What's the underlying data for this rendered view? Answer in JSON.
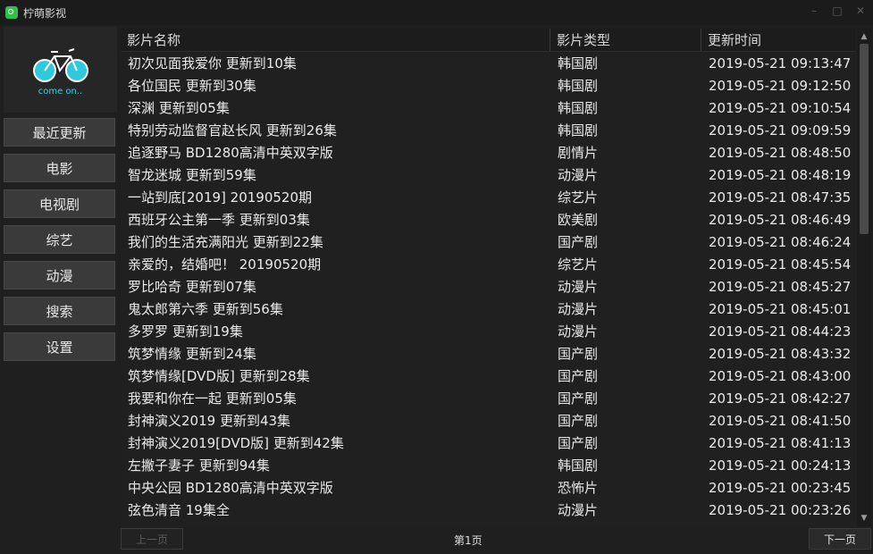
{
  "window": {
    "title": "柠萌影视",
    "app_icon": "app-logo-icon",
    "controls": [
      "minimize-icon",
      "maximize-icon",
      "close-icon"
    ]
  },
  "logo": {
    "text": "come on..",
    "icon": "bicycle-icon",
    "accent_color": "#3fd0e6"
  },
  "nav": [
    {
      "label": "最近更新"
    },
    {
      "label": "电影"
    },
    {
      "label": "电视剧"
    },
    {
      "label": "综艺"
    },
    {
      "label": "动漫"
    },
    {
      "label": "搜索"
    },
    {
      "label": "设置"
    }
  ],
  "table": {
    "headers": [
      "影片名称",
      "影片类型",
      "更新时间"
    ],
    "rows": [
      [
        "初次见面我爱你 更新到10集",
        "韩国剧",
        "2019-05-21 09:13:47"
      ],
      [
        "各位国民 更新到30集",
        "韩国剧",
        "2019-05-21 09:12:50"
      ],
      [
        "深渊 更新到05集",
        "韩国剧",
        "2019-05-21 09:10:54"
      ],
      [
        "特别劳动监督官赵长风 更新到26集",
        "韩国剧",
        "2019-05-21 09:09:59"
      ],
      [
        "追逐野马 BD1280高清中英双字版",
        "剧情片",
        "2019-05-21 08:48:50"
      ],
      [
        "智龙迷城 更新到59集",
        "动漫片",
        "2019-05-21 08:48:19"
      ],
      [
        "一站到底[2019] 20190520期",
        "综艺片",
        "2019-05-21 08:47:35"
      ],
      [
        "西班牙公主第一季 更新到03集",
        "欧美剧",
        "2019-05-21 08:46:49"
      ],
      [
        "我们的生活充满阳光 更新到22集",
        "国产剧",
        "2019-05-21 08:46:24"
      ],
      [
        "亲爱的，结婚吧！ 20190520期",
        "综艺片",
        "2019-05-21 08:45:54"
      ],
      [
        "罗比哈奇 更新到07集",
        "动漫片",
        "2019-05-21 08:45:27"
      ],
      [
        "鬼太郎第六季 更新到56集",
        "动漫片",
        "2019-05-21 08:45:01"
      ],
      [
        "多罗罗 更新到19集",
        "动漫片",
        "2019-05-21 08:44:23"
      ],
      [
        "筑梦情缘 更新到24集",
        "国产剧",
        "2019-05-21 08:43:32"
      ],
      [
        "筑梦情缘[DVD版] 更新到28集",
        "国产剧",
        "2019-05-21 08:43:00"
      ],
      [
        "我要和你在一起 更新到05集",
        "国产剧",
        "2019-05-21 08:42:27"
      ],
      [
        "封神演义2019 更新到43集",
        "国产剧",
        "2019-05-21 08:41:50"
      ],
      [
        "封神演义2019[DVD版] 更新到42集",
        "国产剧",
        "2019-05-21 08:41:13"
      ],
      [
        "左撇子妻子 更新到94集",
        "韩国剧",
        "2019-05-21 00:24:13"
      ],
      [
        "中央公园 BD1280高清中英双字版",
        "恐怖片",
        "2019-05-21 00:23:45"
      ],
      [
        "弦色清音 19集全",
        "动漫片",
        "2019-05-21 00:23:26"
      ]
    ]
  },
  "pagination": {
    "prev_label": "上一页",
    "page_label": "第1页",
    "next_label": "下一页"
  }
}
